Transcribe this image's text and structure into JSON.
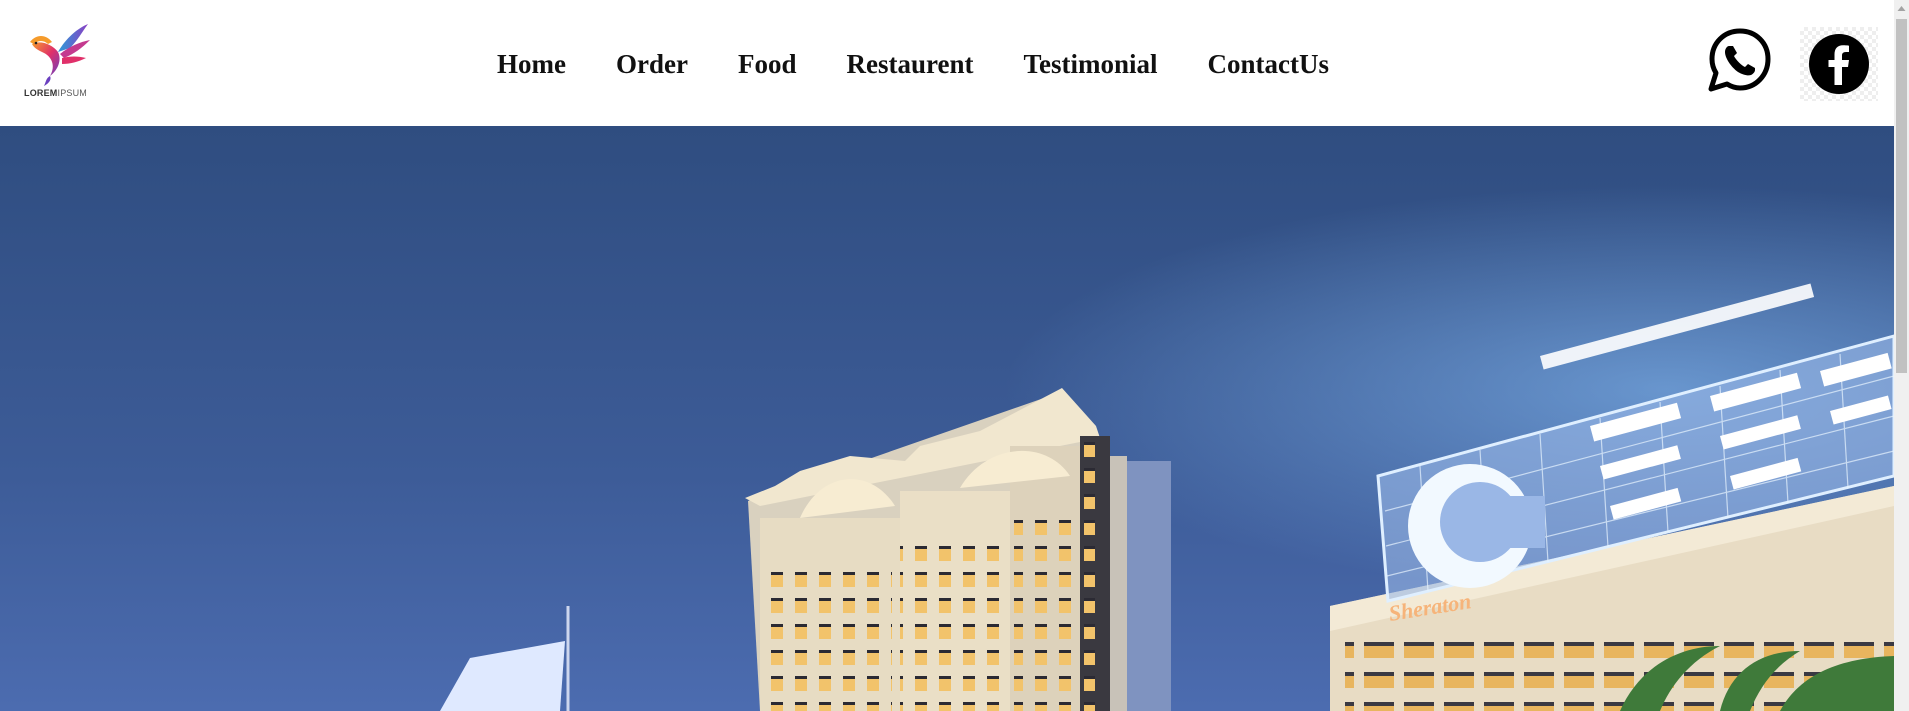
{
  "brand": {
    "logo_icon": "bird-logo-icon",
    "logo_word_bold": "LOREM",
    "logo_word_light": "IPSUM"
  },
  "nav": {
    "items": [
      {
        "label": "Home"
      },
      {
        "label": "Order"
      },
      {
        "label": "Food"
      },
      {
        "label": "Restaurent"
      },
      {
        "label": "Testimonial"
      },
      {
        "label": "ContactUs"
      }
    ]
  },
  "social": {
    "whatsapp_icon": "whatsapp-icon",
    "facebook_icon": "facebook-icon"
  },
  "hero": {
    "description_icon": "city-night-hotel-hero-image",
    "sign_text": "Sheraton"
  },
  "colors": {
    "header_bg": "#ffffff",
    "nav_text": "#111111",
    "sky_top": "#2d4a7c",
    "sky_bottom": "#4a6cb0"
  }
}
